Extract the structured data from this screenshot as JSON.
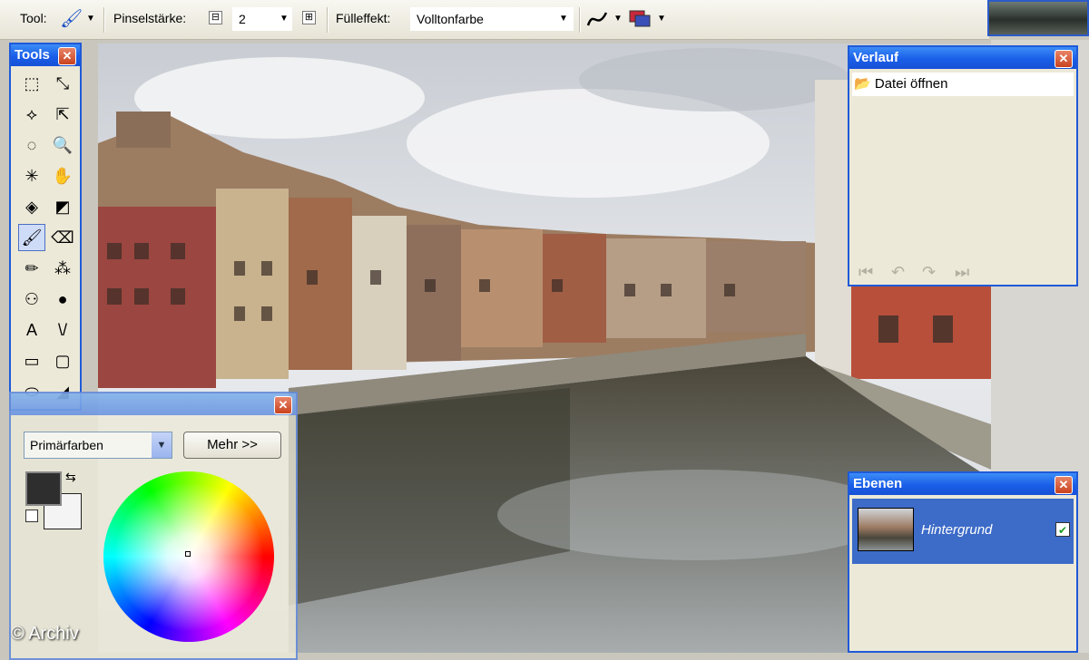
{
  "toolbar": {
    "tool_label": "Tool:",
    "brush_label": "Pinselstärke:",
    "brush_value": "2",
    "fill_label": "Fülleffekt:",
    "fill_value": "Volltonfarbe",
    "minus": "⊟",
    "plus": "⊞"
  },
  "tools_window": {
    "title": "Tools",
    "close": "✕",
    "items": [
      {
        "icon": "⬚",
        "name": "rectangle-select-icon"
      },
      {
        "icon": "⤡",
        "name": "move-selection-icon"
      },
      {
        "icon": "⟡",
        "name": "lasso-select-icon"
      },
      {
        "icon": "⇱",
        "name": "move-selected-icon"
      },
      {
        "icon": "◌",
        "name": "ellipse-select-icon"
      },
      {
        "icon": "🔍",
        "name": "zoom-icon"
      },
      {
        "icon": "✳",
        "name": "magic-wand-icon"
      },
      {
        "icon": "✋",
        "name": "pan-icon"
      },
      {
        "icon": "◈",
        "name": "paint-bucket-icon"
      },
      {
        "icon": "◩",
        "name": "gradient-icon"
      },
      {
        "icon": "🖌",
        "name": "paintbrush-icon"
      },
      {
        "icon": "⌫",
        "name": "eraser-icon"
      },
      {
        "icon": "✏",
        "name": "pencil-icon"
      },
      {
        "icon": "⁂",
        "name": "color-picker-icon"
      },
      {
        "icon": "⚇",
        "name": "clone-stamp-icon"
      },
      {
        "icon": "●",
        "name": "recolor-icon"
      },
      {
        "icon": "A",
        "name": "text-icon"
      },
      {
        "icon": "\\/",
        "name": "line-curve-icon"
      },
      {
        "icon": "▭",
        "name": "rectangle-icon"
      },
      {
        "icon": "▢",
        "name": "rounded-rectangle-icon"
      },
      {
        "icon": "⬭",
        "name": "ellipse-icon"
      },
      {
        "icon": "◢",
        "name": "freeform-shape-icon"
      }
    ]
  },
  "history_window": {
    "title": "Verlauf",
    "close": "✕",
    "item": "Datei öffnen",
    "buttons": [
      "⏮",
      "↶",
      "↷",
      "⏭"
    ]
  },
  "layers_window": {
    "title": "Ebenen",
    "close": "✕",
    "layer_name": "Hintergrund",
    "check": "✔"
  },
  "colors_window": {
    "close": "✕",
    "palette_select": "Primärfarben",
    "more_button": "Mehr >>",
    "swap_icon": "⇆",
    "primary_color": "#2e2e2e",
    "secondary_color": "#f4f4f4"
  },
  "watermark": "© Archiv"
}
